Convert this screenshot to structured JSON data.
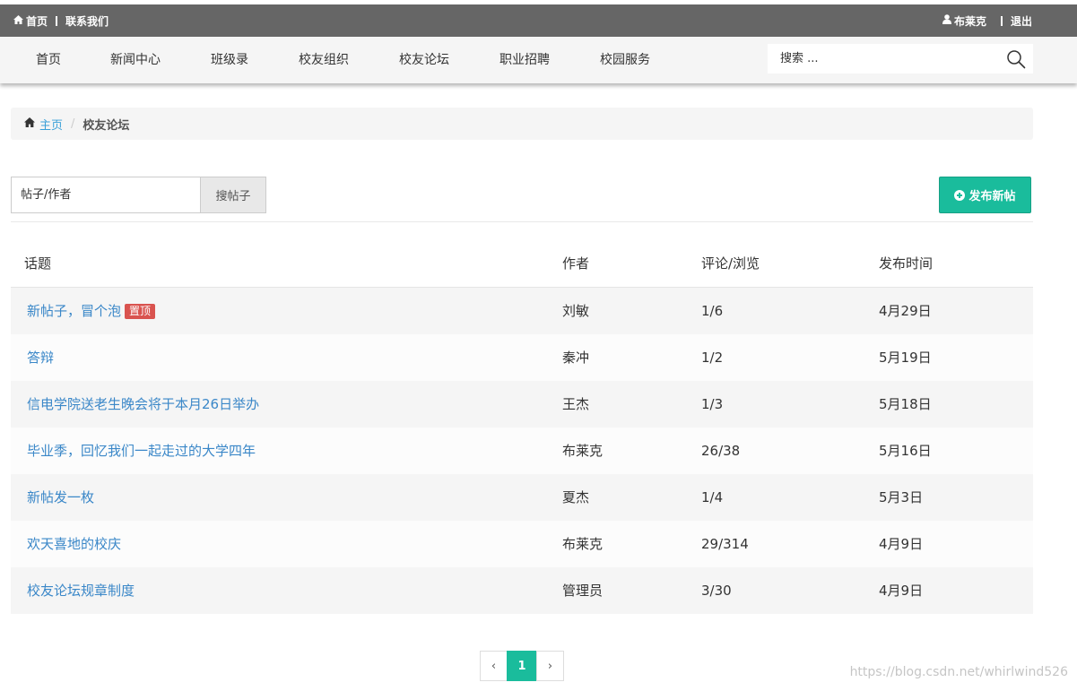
{
  "topbar": {
    "home_label": "首页",
    "contact_label": "联系我们",
    "user_label": "布莱克",
    "logout_label": "退出"
  },
  "nav": {
    "items": [
      {
        "label": "首页"
      },
      {
        "label": "新闻中心"
      },
      {
        "label": "班级录"
      },
      {
        "label": "校友组织"
      },
      {
        "label": "校友论坛"
      },
      {
        "label": "职业招聘"
      },
      {
        "label": "校园服务"
      }
    ],
    "search_placeholder": "搜索 ..."
  },
  "breadcrumb": {
    "home_label": "主页",
    "divider": "/",
    "current": "校友论坛"
  },
  "forum_search": {
    "placeholder": "帖子/作者",
    "button_label": "搜帖子"
  },
  "new_post_label": "发布新帖",
  "table": {
    "headers": {
      "topic": "话题",
      "author": "作者",
      "stats": "评论/浏览",
      "date": "发布时间"
    },
    "rows": [
      {
        "topic": "新帖子，冒个泡",
        "badge": "置顶",
        "author": "刘敏",
        "stats": "1/6",
        "date": "4月29日"
      },
      {
        "topic": "答辩",
        "author": "秦冲",
        "stats": "1/2",
        "date": "5月19日"
      },
      {
        "topic": "信电学院送老生晚会将于本月26日举办",
        "author": "王杰",
        "stats": "1/3",
        "date": "5月18日"
      },
      {
        "topic": "毕业季，回忆我们一起走过的大学四年",
        "author": "布莱克",
        "stats": "26/38",
        "date": "5月16日"
      },
      {
        "topic": "新帖发一枚",
        "author": "夏杰",
        "stats": "1/4",
        "date": "5月3日"
      },
      {
        "topic": "欢天喜地的校庆",
        "author": "布莱克",
        "stats": "29/314",
        "date": "4月9日"
      },
      {
        "topic": "校友论坛规章制度",
        "author": "管理员",
        "stats": "3/30",
        "date": "4月9日"
      }
    ]
  },
  "pagination": {
    "prev": "‹",
    "current": "1",
    "next": "›"
  },
  "watermark": "https://blog.csdn.net/whirlwind526",
  "colors": {
    "topbar_bg": "#666666",
    "accent": "#1abc9c",
    "link": "#3a87c8",
    "badge": "#d9534f"
  }
}
